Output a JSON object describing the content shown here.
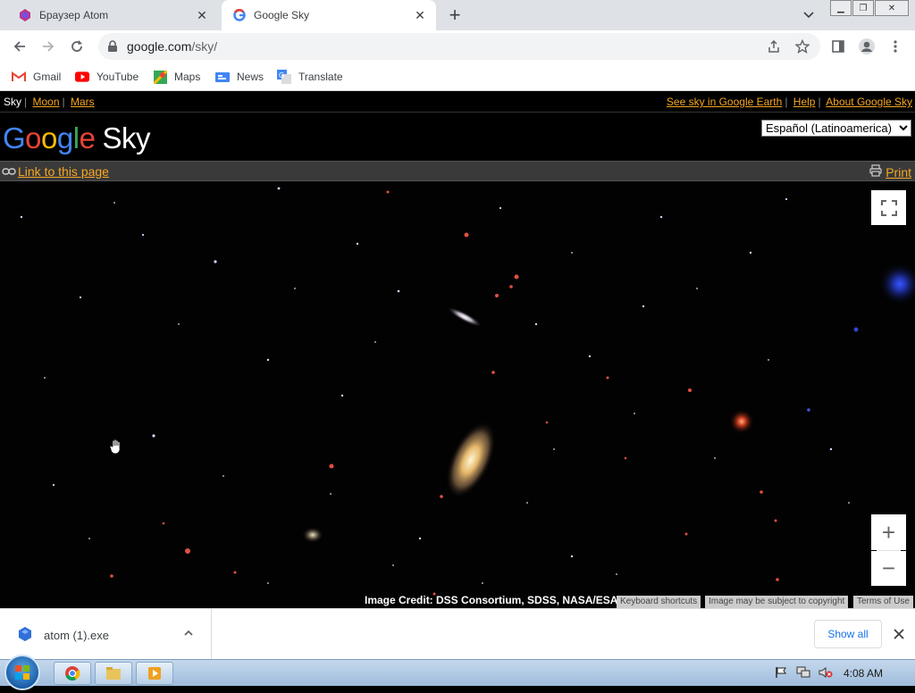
{
  "browser": {
    "tabs": [
      {
        "title": "Браузер Atom",
        "active": false
      },
      {
        "title": "Google Sky",
        "active": true
      }
    ],
    "address": {
      "host": "google.com",
      "path": "/sky/"
    },
    "bookmarks": [
      {
        "label": "Gmail",
        "icon": "gmail-icon"
      },
      {
        "label": "YouTube",
        "icon": "youtube-icon"
      },
      {
        "label": "Maps",
        "icon": "maps-icon"
      },
      {
        "label": "News",
        "icon": "news-icon"
      },
      {
        "label": "Translate",
        "icon": "translate-icon"
      }
    ]
  },
  "sky": {
    "nav_left": {
      "current": "Sky",
      "moon": "Moon",
      "mars": "Mars"
    },
    "nav_right": {
      "earth": "See sky in Google Earth",
      "help": "Help",
      "about": "About Google Sky"
    },
    "logo": {
      "g1": "G",
      "o1": "o",
      "o2": "o",
      "g2": "g",
      "l": "l",
      "e": "e",
      "sky": "Sky"
    },
    "language": "Español (Latinoamerica)",
    "link_label": "Link to this page",
    "print_label": "Print",
    "zoom_in": "+",
    "zoom_out": "−",
    "credit": "Image Credit: DSS Consortium, SDSS, NASA/ESA",
    "attrib": {
      "shortcuts": "Keyboard shortcuts",
      "copyright": "Image may be subject to copyright",
      "terms": "Terms of Use"
    }
  },
  "download": {
    "file": "atom (1).exe",
    "show_all": "Show all"
  },
  "taskbar": {
    "time": "4:08 AM"
  },
  "colors": {
    "link": "#f5a623",
    "accent": "#1a73e8"
  }
}
